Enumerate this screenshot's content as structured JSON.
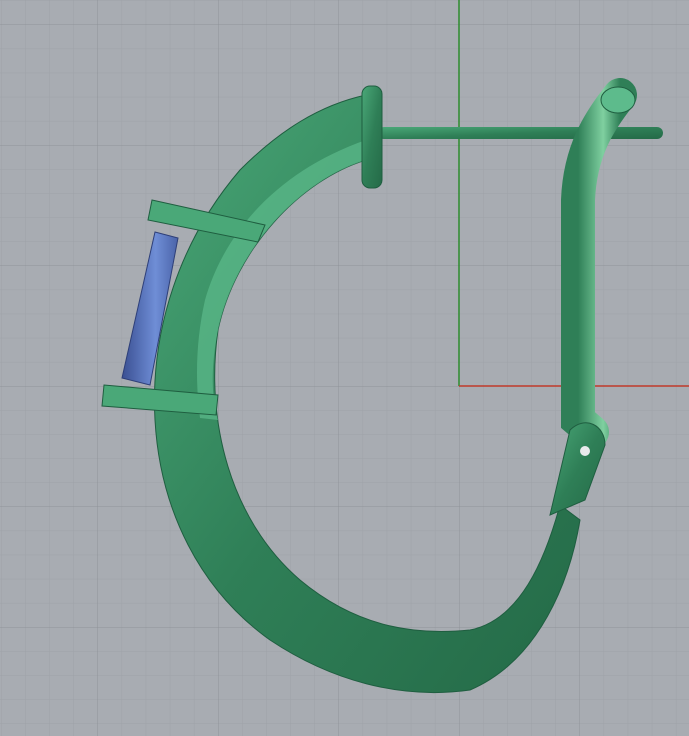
{
  "viewport": {
    "view": "Perspective",
    "background_color": "#a8acb2",
    "grid_minor_color": "#9ea2a8",
    "grid_major_color": "#8f9399",
    "x_axis_color": "#c0392b",
    "y_axis_color": "#2e8b2e"
  },
  "model": {
    "name": "earring",
    "metal_color": "#3d9a6c",
    "gem_color": "#5b78c0"
  }
}
